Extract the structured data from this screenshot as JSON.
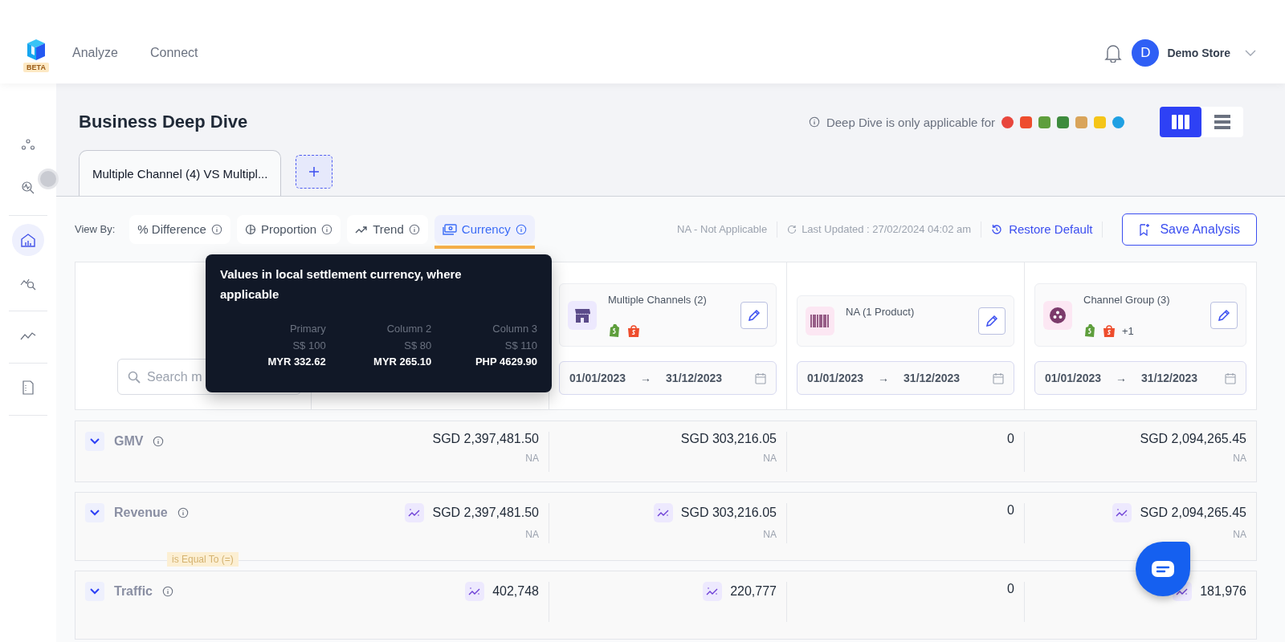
{
  "header": {
    "logo_badge": "BETA",
    "nav": [
      {
        "label": "Analyze"
      },
      {
        "label": "Connect"
      }
    ],
    "avatar_initial": "D",
    "store_name": "Demo Store"
  },
  "sidebar": {
    "groups": [
      [
        {
          "selected": false
        },
        {
          "selected": false
        }
      ],
      [
        {
          "selected": true
        },
        {
          "selected": false
        }
      ],
      [
        {
          "selected": false
        }
      ],
      [
        {
          "selected": false
        }
      ]
    ]
  },
  "page": {
    "title": "Business Deep Dive",
    "notice": "Deep Dive is only applicable for",
    "layout_options": [
      {
        "kind": "columns",
        "selected": true
      },
      {
        "kind": "rows",
        "selected": false
      }
    ]
  },
  "tabs": [
    {
      "label": "Multiple Channel (4) VS Multipl..."
    }
  ],
  "view_by": {
    "label": "View By:",
    "options": [
      {
        "kind": "percent",
        "label": "% Difference",
        "selected": false
      },
      {
        "kind": "proportion",
        "label": "Proportion",
        "selected": false
      },
      {
        "kind": "trend",
        "label": "Trend",
        "selected": false
      },
      {
        "kind": "currency",
        "label": "Currency",
        "selected": true
      }
    ]
  },
  "toolbar": {
    "na_note": "NA - Not Applicable",
    "last_updated": "Last Updated : 27/02/2024 04:02 am",
    "restore": "Restore Default",
    "save": "Save Analysis"
  },
  "search": {
    "placeholder": "Search m"
  },
  "compare_columns": [
    {
      "kind": "channels",
      "name": "Multiple Channels (2)",
      "start": "01/01/2023",
      "separator": "→",
      "end": "31/12/2023"
    },
    {
      "kind": "product",
      "name": "NA (1 Product)",
      "start": "01/01/2023",
      "separator": "→",
      "end": "31/12/2023"
    },
    {
      "kind": "group",
      "name": "Channel Group (3)",
      "more": "+1",
      "start": "01/01/2023",
      "separator": "→",
      "end": "31/12/2023"
    }
  ],
  "tooltip": {
    "title": "Values in local settlement currency, where applicable",
    "columns": [
      {
        "label": "Primary",
        "base": "S$ 100",
        "local": "MYR 332.62"
      },
      {
        "label": "Column 2",
        "base": "S$ 80",
        "local": "MYR 265.10"
      },
      {
        "label": "Column 3",
        "base": "S$ 110",
        "local": "PHP 4629.90"
      }
    ]
  },
  "metrics": [
    {
      "name": "GMV",
      "cells": [
        {
          "value": "SGD 2,397,481.50",
          "note": "NA",
          "trend": false
        },
        {
          "value": "SGD 303,216.05",
          "note": "NA",
          "trend": false
        },
        {
          "value": "0",
          "trend": false
        },
        {
          "value": "SGD 2,094,265.45",
          "note": "NA",
          "trend": false
        }
      ]
    },
    {
      "name": "Revenue",
      "cells": [
        {
          "value": "SGD 2,397,481.50",
          "note": "NA",
          "trend": true
        },
        {
          "value": "SGD 303,216.05",
          "note": "NA",
          "trend": true
        },
        {
          "value": "0",
          "trend": false
        },
        {
          "value": "SGD 2,094,265.45",
          "note": "NA",
          "trend": true
        }
      ]
    },
    {
      "name": "Traffic",
      "cells": [
        {
          "value": "402,748",
          "trend": true
        },
        {
          "value": "220,777",
          "trend": true
        },
        {
          "value": "0",
          "trend": false
        },
        {
          "value": "181,976",
          "trend": true
        }
      ]
    }
  ],
  "filter_tag": "is Equal To (=)"
}
